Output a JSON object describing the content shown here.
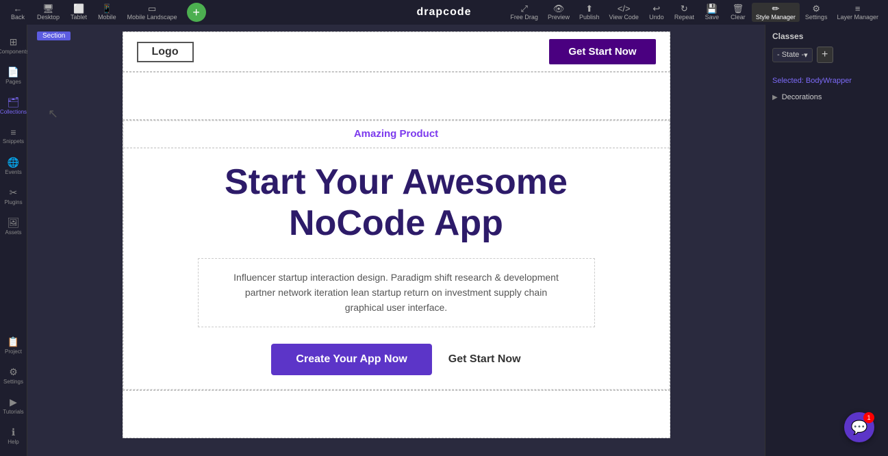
{
  "toolbar": {
    "brand": "drapcode",
    "left_buttons": [
      {
        "label": "Back",
        "icon": "←",
        "name": "back-button"
      },
      {
        "label": "Desktop",
        "icon": "🖥",
        "name": "desktop-button"
      },
      {
        "label": "Tablet",
        "icon": "⬜",
        "name": "tablet-button"
      },
      {
        "label": "Mobile",
        "icon": "📱",
        "name": "mobile-button"
      },
      {
        "label": "Mobile Landscape",
        "icon": "▭",
        "name": "mobile-landscape-button"
      }
    ],
    "right_buttons": [
      {
        "label": "Free Drag",
        "icon": "⤢",
        "name": "free-drag-button"
      },
      {
        "label": "Preview",
        "icon": "👁",
        "name": "preview-button"
      },
      {
        "label": "Publish",
        "icon": "⬆",
        "name": "publish-button"
      },
      {
        "label": "View Code",
        "icon": "</>",
        "name": "view-code-button"
      },
      {
        "label": "Undo",
        "icon": "↩",
        "name": "undo-button"
      },
      {
        "label": "Repeat",
        "icon": "↻",
        "name": "repeat-button"
      },
      {
        "label": "Save",
        "icon": "💾",
        "name": "save-button"
      },
      {
        "label": "Clear",
        "icon": "🗑",
        "name": "clear-button"
      },
      {
        "label": "Style Manager",
        "icon": "✏",
        "name": "style-manager-button"
      },
      {
        "label": "Settings",
        "icon": "⚙",
        "name": "settings-button"
      },
      {
        "label": "Layer Manager",
        "icon": "≡",
        "name": "layer-manager-button"
      }
    ]
  },
  "sidebar": {
    "items": [
      {
        "label": "Components",
        "icon": "⊞",
        "name": "components"
      },
      {
        "label": "Pages",
        "icon": "📄",
        "name": "pages"
      },
      {
        "label": "Collections",
        "icon": "🗂",
        "name": "collections",
        "active": true
      },
      {
        "label": "Snippets",
        "icon": "≡",
        "name": "snippets"
      },
      {
        "label": "Events",
        "icon": "🌐",
        "name": "events"
      },
      {
        "label": "Plugins",
        "icon": "✂",
        "name": "plugins"
      },
      {
        "label": "Assets",
        "icon": "🖼",
        "name": "assets"
      },
      {
        "label": "Project",
        "icon": "📋",
        "name": "project"
      },
      {
        "label": "Settings",
        "icon": "⚙",
        "name": "settings"
      },
      {
        "label": "Tutorials",
        "icon": "▶",
        "name": "tutorials"
      },
      {
        "label": "Help",
        "icon": "ℹ",
        "name": "help"
      }
    ]
  },
  "section_tag": "Section",
  "canvas": {
    "nav": {
      "logo_text": "Logo",
      "get_start_label": "Get Start Now"
    },
    "hero": {
      "amazing_label": "Amazing Product",
      "title_line1": "Start Your Awesome",
      "title_line2": "NoCode App",
      "description": "Influencer startup interaction design. Paradigm shift research & development partner network iteration lean startup return on investment supply chain graphical user interface.",
      "create_btn_label": "Create Your App Now",
      "get_start_link_label": "Get Start Now"
    }
  },
  "right_panel": {
    "title": "Classes",
    "state_label": "- State -",
    "add_label": "+",
    "selected_label": "Selected: BodyWrapper",
    "decorations_label": "Decorations"
  },
  "chat": {
    "badge": "1"
  }
}
